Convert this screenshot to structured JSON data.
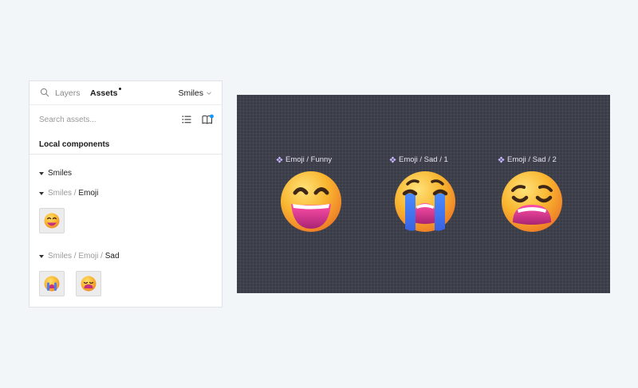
{
  "panel": {
    "tabs": {
      "layers": "Layers",
      "assets": "Assets"
    },
    "library": "Smiles",
    "search_placeholder": "Search assets...",
    "section_title": "Local components",
    "tree": {
      "smiles": "Smiles",
      "emoji": {
        "parent": "Smiles",
        "sep": " / ",
        "name": "Emoji"
      },
      "sad": {
        "parent1": "Smiles",
        "sep1": " / ",
        "parent2": "Emoji",
        "sep2": " / ",
        "name": "Sad"
      }
    },
    "icons": [
      "search-icon",
      "list-view-icon",
      "library-book-icon",
      "chevron-down-icon"
    ]
  },
  "canvas": {
    "components": [
      {
        "label": "Emoji / Funny",
        "emoji": "grinning-squinting-face"
      },
      {
        "label": "Emoji / Sad / 1",
        "emoji": "loudly-crying-face"
      },
      {
        "label": "Emoji / Sad / 2",
        "emoji": "weary-face"
      }
    ]
  },
  "colors": {
    "canvas_bg": "#3a3d47",
    "component_label": "#c7b6ff",
    "accent_dot": "#0d99ff",
    "emoji_yellow": "#f7b733",
    "emoji_mouth": "#d63a8b"
  }
}
